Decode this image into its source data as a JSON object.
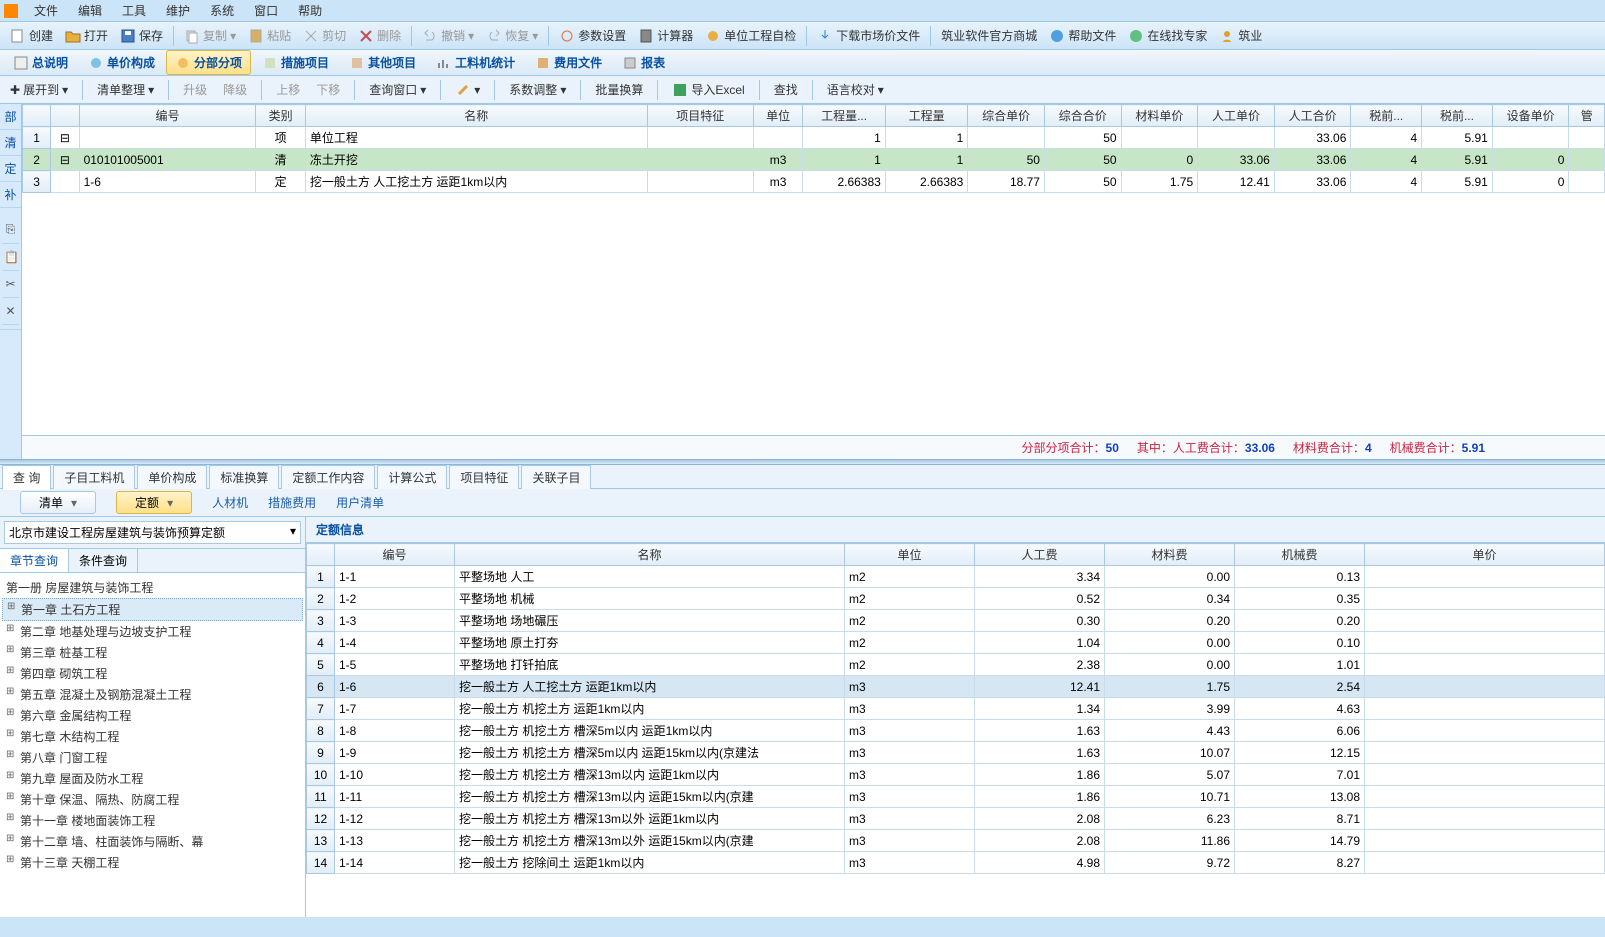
{
  "menu": [
    "文件",
    "编辑",
    "工具",
    "维护",
    "系统",
    "窗口",
    "帮助"
  ],
  "toolbar1": {
    "create": "创建",
    "open": "打开",
    "save": "保存",
    "copy": "复制",
    "paste": "粘贴",
    "cut": "剪切",
    "delete": "删除",
    "undo": "撤销",
    "redo": "恢复",
    "param": "参数设置",
    "calc": "计算器",
    "selfcheck": "单位工程自检",
    "dlmkt": "下载市场价文件",
    "mall": "筑业软件官方商城",
    "helpfile": "帮助文件",
    "expert": "在线找专家",
    "zy": "筑业"
  },
  "tabs1": [
    "总说明",
    "单价构成",
    "分部分项",
    "措施项目",
    "其他项目",
    "工料机统计",
    "费用文件",
    "报表"
  ],
  "toolbar2": {
    "expandto": "展开到",
    "listorg": "清单整理",
    "up": "升级",
    "down": "降级",
    "moveup": "上移",
    "movedown": "下移",
    "querywin": "查询窗口",
    "coef": "系数调整",
    "batch": "批量换算",
    "excel": "导入Excel",
    "find": "查找",
    "voice": "语言校对"
  },
  "grid1": {
    "headers": [
      "",
      "编号",
      "类别",
      "名称",
      "项目特征",
      "单位",
      "工程量...",
      "工程量",
      "综合单价",
      "综合合价",
      "材料单价",
      "人工单价",
      "人工合价",
      "税前...",
      "税前...",
      "设备单价",
      "管"
    ],
    "rows": [
      {
        "rn": "1",
        "bh": "",
        "lb": "项",
        "mc": "单位工程",
        "tz": "",
        "dw": "",
        "gclf": "1",
        "gcl": "1",
        "zhdj": "",
        "zhhj": "50",
        "cldj": "",
        "rgdj": "",
        "rghj": "33.06",
        "sq1": "4",
        "sq2": "5.91",
        "sbdj": ""
      },
      {
        "rn": "2",
        "bh": "010101005001",
        "lb": "清",
        "mc": "冻土开挖",
        "tz": "",
        "dw": "m3",
        "gclf": "1",
        "gcl": "1",
        "zhdj": "50",
        "zhhj": "50",
        "cldj": "0",
        "rgdj": "33.06",
        "rghj": "33.06",
        "sq1": "4",
        "sq2": "5.91",
        "sbdj": "0",
        "sel": true
      },
      {
        "rn": "3",
        "bh": "1-6",
        "lb": "定",
        "mc": "挖一般土方  人工挖土方  运距1km以内",
        "tz": "",
        "dw": "m3",
        "gclf": "2.66383",
        "gcl": "2.66383",
        "zhdj": "18.77",
        "zhhj": "50",
        "cldj": "1.75",
        "rgdj": "12.41",
        "rghj": "33.06",
        "sq1": "4",
        "sq2": "5.91",
        "sbdj": "0"
      }
    ]
  },
  "status": {
    "l1": "分部分项合计：",
    "v1": "50",
    "l2": "其中：人工费合计：",
    "v2": "33.06",
    "l3": "材料费合计：",
    "v3": "4",
    "l4": "机械费合计：",
    "v4": "5.91"
  },
  "bottom_tabs": [
    "查 询",
    "子目工料机",
    "单价构成",
    "标准换算",
    "定额工作内容",
    "计算公式",
    "项目特征",
    "关联子目"
  ],
  "query_bar": {
    "qd": "清单",
    "de": "定额",
    "rcj": "人材机",
    "csfy": "措施费用",
    "yhqd": "用户清单"
  },
  "combo": "北京市建设工程房屋建筑与装饰预算定额",
  "subtabs": [
    "章节查询",
    "条件查询"
  ],
  "tree": [
    {
      "t": "第一册  房屋建筑与装饰工程",
      "root": true
    },
    {
      "t": "第一章  土石方工程",
      "sel": true
    },
    {
      "t": "第二章  地基处理与边坡支护工程"
    },
    {
      "t": "第三章  桩基工程"
    },
    {
      "t": "第四章  砌筑工程"
    },
    {
      "t": "第五章  混凝土及钢筋混凝土工程"
    },
    {
      "t": "第六章  金属结构工程"
    },
    {
      "t": "第七章  木结构工程"
    },
    {
      "t": "第八章  门窗工程"
    },
    {
      "t": "第九章  屋面及防水工程"
    },
    {
      "t": "第十章  保温、隔热、防腐工程"
    },
    {
      "t": "第十一章  楼地面装饰工程"
    },
    {
      "t": "第十二章  墙、柱面装饰与隔断、幕"
    },
    {
      "t": "第十三章  天棚工程"
    }
  ],
  "panel_title": "定额信息",
  "grid2": {
    "headers": [
      "",
      "编号",
      "名称",
      "单位",
      "人工费",
      "材料费",
      "机械费",
      "单价"
    ],
    "rows": [
      {
        "rn": "1",
        "bh": "1-1",
        "mc": "平整场地  人工",
        "dw": "m2",
        "rg": "3.34",
        "cl": "0.00",
        "jx": "0.13"
      },
      {
        "rn": "2",
        "bh": "1-2",
        "mc": "平整场地  机械",
        "dw": "m2",
        "rg": "0.52",
        "cl": "0.34",
        "jx": "0.35"
      },
      {
        "rn": "3",
        "bh": "1-3",
        "mc": "平整场地  场地碾压",
        "dw": "m2",
        "rg": "0.30",
        "cl": "0.20",
        "jx": "0.20"
      },
      {
        "rn": "4",
        "bh": "1-4",
        "mc": "平整场地  原土打夯",
        "dw": "m2",
        "rg": "1.04",
        "cl": "0.00",
        "jx": "0.10"
      },
      {
        "rn": "5",
        "bh": "1-5",
        "mc": "平整场地  打钎拍底",
        "dw": "m2",
        "rg": "2.38",
        "cl": "0.00",
        "jx": "1.01"
      },
      {
        "rn": "6",
        "bh": "1-6",
        "mc": "挖一般土方  人工挖土方  运距1km以内",
        "dw": "m3",
        "rg": "12.41",
        "cl": "1.75",
        "jx": "2.54",
        "hl": true
      },
      {
        "rn": "7",
        "bh": "1-7",
        "mc": "挖一般土方  机挖土方  运距1km以内",
        "dw": "m3",
        "rg": "1.34",
        "cl": "3.99",
        "jx": "4.63"
      },
      {
        "rn": "8",
        "bh": "1-8",
        "mc": "挖一般土方  机挖土方  槽深5m以内  运距1km以内",
        "dw": "m3",
        "rg": "1.63",
        "cl": "4.43",
        "jx": "6.06"
      },
      {
        "rn": "9",
        "bh": "1-9",
        "mc": "挖一般土方  机挖土方  槽深5m以内  运距15km以内(京建法",
        "dw": "m3",
        "rg": "1.63",
        "cl": "10.07",
        "jx": "12.15"
      },
      {
        "rn": "10",
        "bh": "1-10",
        "mc": "挖一般土方  机挖土方  槽深13m以内  运距1km以内",
        "dw": "m3",
        "rg": "1.86",
        "cl": "5.07",
        "jx": "7.01"
      },
      {
        "rn": "11",
        "bh": "1-11",
        "mc": "挖一般土方  机挖土方  槽深13m以内  运距15km以内(京建",
        "dw": "m3",
        "rg": "1.86",
        "cl": "10.71",
        "jx": "13.08"
      },
      {
        "rn": "12",
        "bh": "1-12",
        "mc": "挖一般土方  机挖土方  槽深13m以外  运距1km以内",
        "dw": "m3",
        "rg": "2.08",
        "cl": "6.23",
        "jx": "8.71"
      },
      {
        "rn": "13",
        "bh": "1-13",
        "mc": "挖一般土方  机挖土方  槽深13m以外  运距15km以内(京建",
        "dw": "m3",
        "rg": "2.08",
        "cl": "11.86",
        "jx": "14.79"
      },
      {
        "rn": "14",
        "bh": "1-14",
        "mc": "挖一般土方  挖除间土  运距1km以内",
        "dw": "m3",
        "rg": "4.98",
        "cl": "9.72",
        "jx": "8.27"
      }
    ]
  },
  "side": [
    "部",
    "清",
    "定",
    "补"
  ]
}
